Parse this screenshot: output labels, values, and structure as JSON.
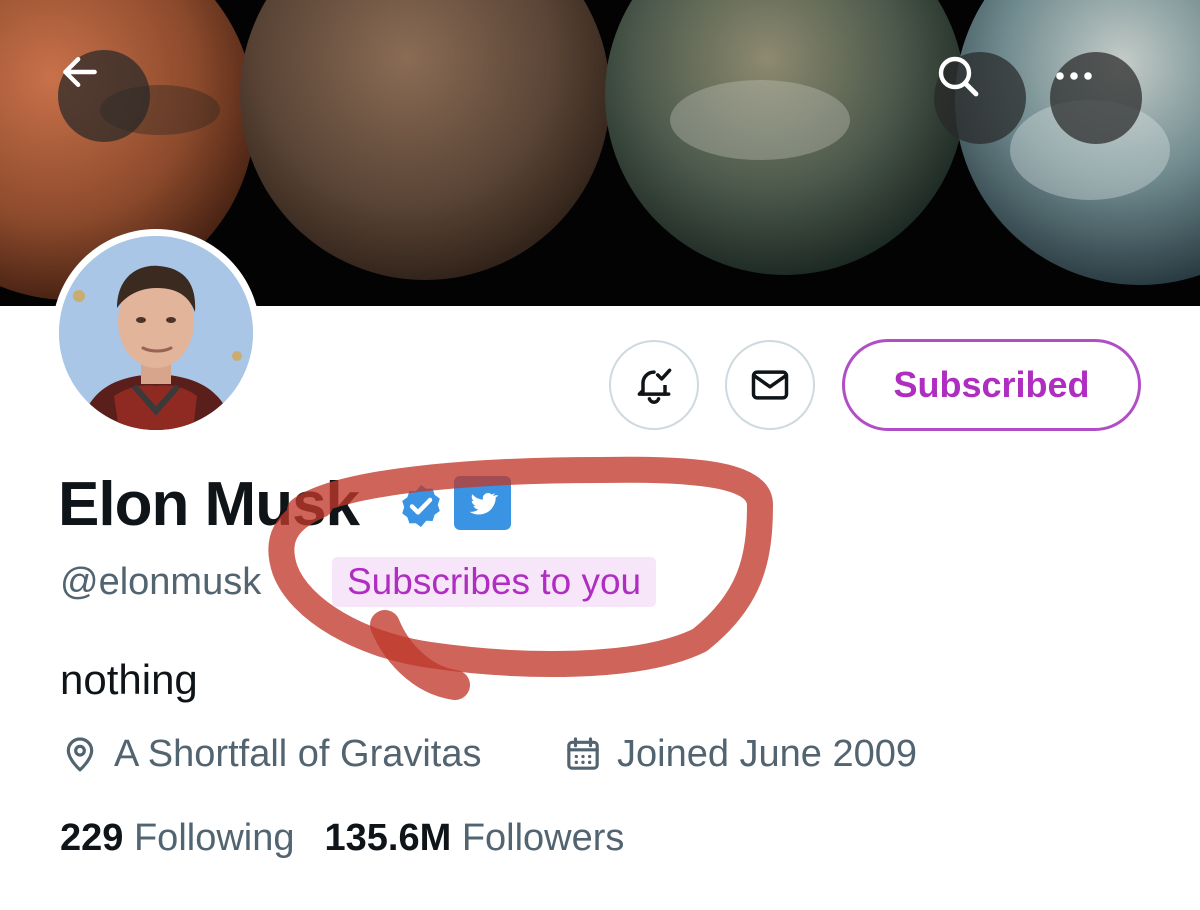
{
  "header": {
    "back_icon": "arrow-left-icon",
    "search_icon": "search-icon",
    "more_icon": "more-horizontal-icon"
  },
  "actions": {
    "notifications_icon": "bell-check-icon",
    "message_icon": "envelope-icon",
    "subscribed_label": "Subscribed"
  },
  "profile": {
    "name": "Elon Musk",
    "handle": "@elonmusk",
    "subscribes_tag": "Subscribes to you",
    "bio": "nothing",
    "location": "A Shortfall of Gravitas",
    "joined": "Joined June 2009",
    "following_count": "229",
    "following_label": "Following",
    "followers_count": "135.6M",
    "followers_label": "Followers"
  },
  "colors": {
    "subscribe_accent": "#b02dc2",
    "verified_blue": "#3a94e3",
    "muted_text": "#536471",
    "annotation_red": "#c0392b"
  }
}
